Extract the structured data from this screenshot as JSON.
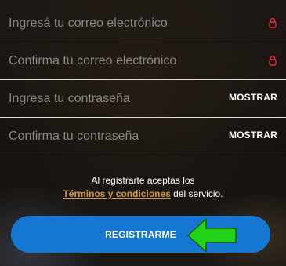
{
  "form": {
    "email": {
      "placeholder": "Ingresá tu correo electrónico",
      "value": ""
    },
    "confirm_email": {
      "placeholder": "Confirma tu correo electrónico",
      "value": ""
    },
    "password": {
      "placeholder": "Ingresa tu contraseña",
      "value": "",
      "toggle_label": "MOSTRAR"
    },
    "confirm_password": {
      "placeholder": "Confirma tu contraseña",
      "value": "",
      "toggle_label": "MOSTRAR"
    }
  },
  "terms": {
    "line1": "Al registrarte aceptas los",
    "link": "Términos y condiciones",
    "suffix": " del servicio."
  },
  "register_label": "REGISTRARME",
  "icons": {
    "email_lock": "lock-icon",
    "confirm_email_lock": "lock-icon",
    "annotation_arrow": "arrow-left-icon"
  },
  "colors": {
    "accent_button": "#1677d2",
    "terms_link": "#d29a2a",
    "lock_icon": "#e0303a",
    "annotation_arrow": "#22d31a"
  }
}
